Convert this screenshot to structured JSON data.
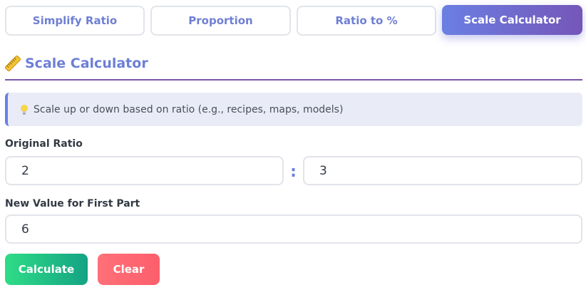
{
  "tabs": [
    {
      "label": "Simplify Ratio",
      "active": false
    },
    {
      "label": "Proportion",
      "active": false
    },
    {
      "label": "Ratio to %",
      "active": false
    },
    {
      "label": "Scale Calculator",
      "active": true
    }
  ],
  "section": {
    "title": "Scale Calculator",
    "icon": "ruler-icon"
  },
  "info": {
    "icon": "lightbulb-icon",
    "text": "Scale up or down based on ratio (e.g., recipes, maps, models)"
  },
  "form": {
    "original_ratio_label": "Original Ratio",
    "ratio_first_value": "2",
    "ratio_separator": ":",
    "ratio_second_value": "3",
    "new_value_label": "New Value for First Part",
    "new_value": "6"
  },
  "buttons": {
    "calculate_label": "Calculate",
    "clear_label": "Clear"
  },
  "colors": {
    "accent": "#6b7fe3",
    "accent_dark": "#7556b8",
    "calculate": "#22c384",
    "clear": "#fc6670"
  }
}
